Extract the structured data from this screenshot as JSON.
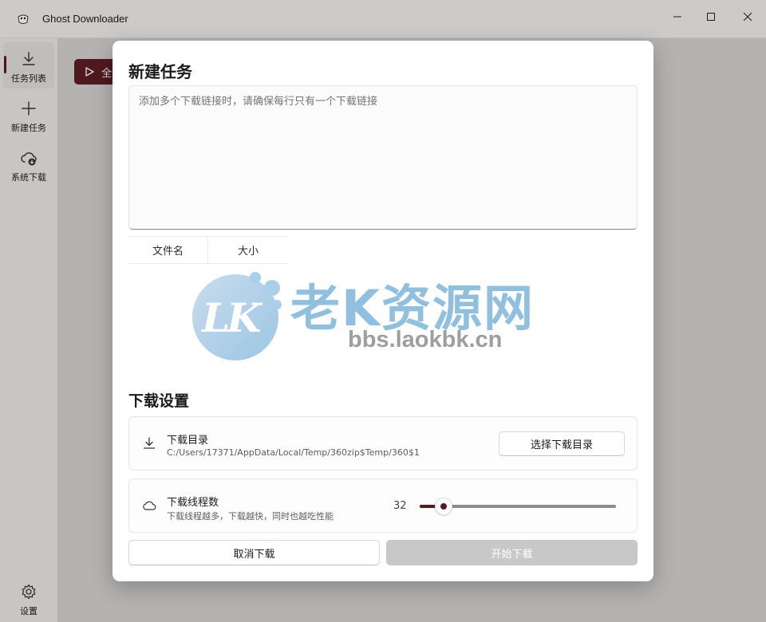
{
  "window": {
    "title": "Ghost Downloader",
    "controls": [
      "minimize-icon",
      "maximize-icon",
      "close-icon"
    ]
  },
  "sidebar": {
    "items": [
      {
        "label": "任务列表",
        "icon": "download-icon",
        "active": true
      },
      {
        "label": "新建任务",
        "icon": "plus-icon",
        "active": false
      },
      {
        "label": "系统下载",
        "icon": "cloud-download-icon",
        "active": false
      }
    ],
    "settings": {
      "label": "设置",
      "icon": "gear-icon"
    }
  },
  "background": {
    "action_button_partial": "全"
  },
  "dialog": {
    "title": "新建任务",
    "url_input": {
      "placeholder": "添加多个下载链接时，请确保每行只有一个下载链接",
      "value": ""
    },
    "table": {
      "columns": [
        "文件名",
        "大小"
      ]
    },
    "settings_title": "下载设置",
    "download_dir": {
      "title": "下载目录",
      "path": "C:/Users/17371/AppData/Local/Temp/360zip$Temp/360$1",
      "button": "选择下载目录",
      "icon": "download-icon"
    },
    "threads": {
      "title": "下载线程数",
      "description": "下载线程越多，下载越快，同时也越吃性能",
      "value": "32",
      "slider_fraction": 0.12,
      "icon": "cloud-icon"
    },
    "cancel_button": "取消下载",
    "start_button": "开始下载"
  },
  "watermark": {
    "logo_text": "LK",
    "name": "老K资源网",
    "url": "bbs.laokbk.cn"
  },
  "colors": {
    "accent": "#5c1a1e",
    "disabled": "#c8c8c8"
  }
}
